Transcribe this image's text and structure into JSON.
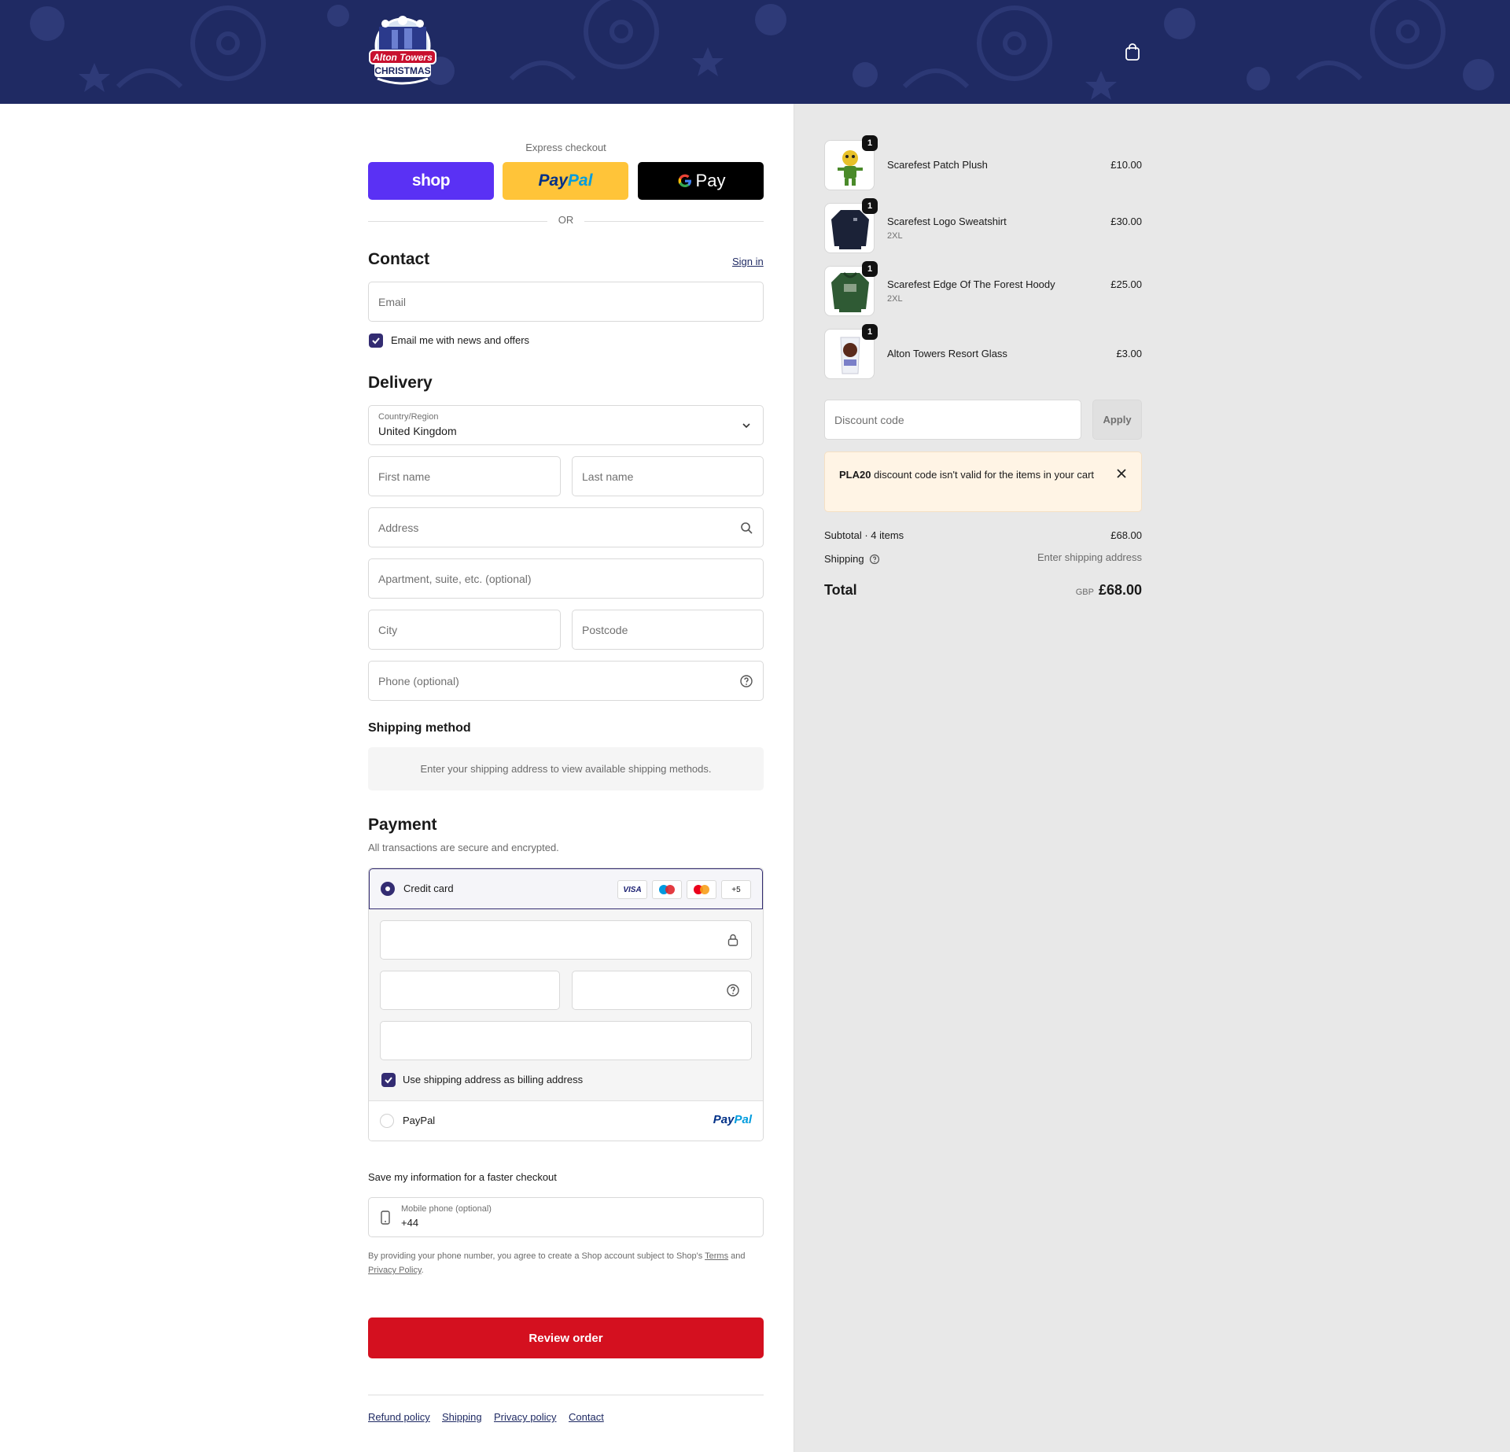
{
  "header": {
    "logo_top": "Alton Towers",
    "logo_bottom": "CHRISTMAS",
    "cart_icon": "shopping-bag-icon",
    "bg": "#1f2a63"
  },
  "express": {
    "label": "Express checkout",
    "shop_label": "shop",
    "paypal_label_1": "Pay",
    "paypal_label_2": "Pal",
    "gpay_label": "Pay",
    "or_label": "OR"
  },
  "contact": {
    "title": "Contact",
    "sign_in": "Sign in",
    "email_placeholder": "Email",
    "newsletter_label": "Email me with news and offers"
  },
  "delivery": {
    "title": "Delivery",
    "country_label": "Country/Region",
    "country_value": "United Kingdom",
    "first_name": "First name",
    "last_name": "Last name",
    "address": "Address",
    "apartment": "Apartment, suite, etc. (optional)",
    "city": "City",
    "postcode": "Postcode",
    "phone": "Phone (optional)"
  },
  "shipping_method": {
    "title": "Shipping method",
    "message": "Enter your shipping address to view available shipping methods."
  },
  "payment": {
    "title": "Payment",
    "subtitle": "All transactions are secure and encrypted.",
    "credit_card": "Credit card",
    "cards": [
      "VISA",
      "+5"
    ],
    "billing_label": "Use shipping address as billing address",
    "paypal": "PayPal",
    "paypal_logo_1": "Pay",
    "paypal_logo_2": "Pal",
    "accent": "#332c72"
  },
  "save_info": {
    "title": "Save my information for a faster checkout",
    "phone_label": "Mobile phone (optional)",
    "phone_value": "+44",
    "terms_1": "By providing your phone number, you agree to create a Shop account subject to Shop's",
    "terms_link": "Terms",
    "terms_2": "and",
    "privacy_link": "Privacy Policy",
    "terms_3": "."
  },
  "review_button": "Review order",
  "footer_links": [
    "Refund policy",
    "Shipping",
    "Privacy policy",
    "Contact"
  ],
  "summary": {
    "items": [
      {
        "name": "Scarefest Patch Plush",
        "variant": "",
        "price": "£10.00",
        "qty": "1"
      },
      {
        "name": "Scarefest Logo Sweatshirt",
        "variant": "2XL",
        "price": "£30.00",
        "qty": "1"
      },
      {
        "name": "Scarefest Edge Of The Forest Hoody",
        "variant": "2XL",
        "price": "£25.00",
        "qty": "1"
      },
      {
        "name": "Alton Towers Resort Glass",
        "variant": "",
        "price": "£3.00",
        "qty": "1"
      }
    ],
    "discount_placeholder": "Discount code",
    "apply": "Apply",
    "alert_code": "PLA20",
    "alert_text": " discount code isn't valid for the items in your cart",
    "subtotal_label": "Subtotal · 4 items",
    "subtotal_value": "£68.00",
    "shipping_label": "Shipping",
    "shipping_value": "Enter shipping address",
    "total_label": "Total",
    "currency": "GBP",
    "total_value": "£68.00"
  }
}
